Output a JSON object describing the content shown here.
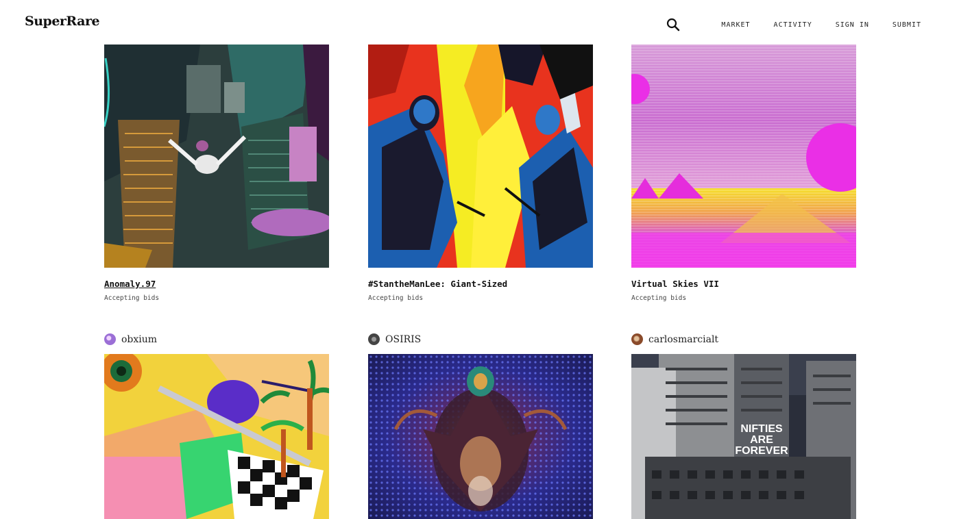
{
  "header": {
    "logo": "SuperRare",
    "nav": [
      "MARKET",
      "ACTIVITY",
      "SIGN IN",
      "SUBMIT"
    ]
  },
  "row1": [
    {
      "title": "Anomaly.97",
      "status": "Accepting bids"
    },
    {
      "title": "#StantheManLee: Giant-Sized",
      "status": "Accepting bids"
    },
    {
      "title": "Virtual Skies VII",
      "status": "Accepting bids"
    }
  ],
  "row2": [
    {
      "owner": "obxium",
      "avatar_color": "#9b6fd6"
    },
    {
      "owner": "OSIRIS",
      "avatar_color": "#555555"
    },
    {
      "owner": "carlosmarcialt",
      "avatar_color": "#b5653a"
    }
  ],
  "artwork_text": {
    "nifties_line1": "NIFTIES",
    "nifties_line2": "ARE",
    "nifties_line3": "FOREVER"
  }
}
